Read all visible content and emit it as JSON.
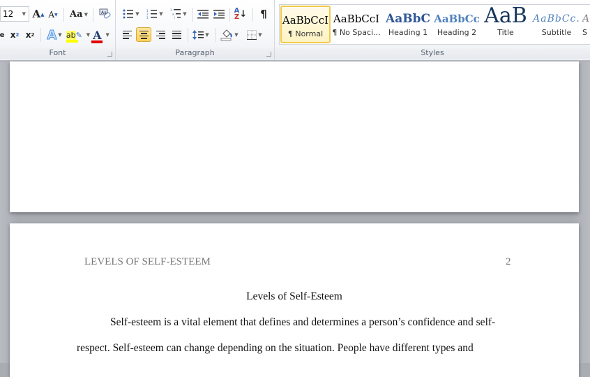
{
  "ribbon": {
    "font_group": {
      "label": "Font",
      "font_size": "12",
      "grow_font": "A",
      "shrink_font": "A",
      "change_case": "Aa",
      "subscript": "x",
      "superscript": "x",
      "text_effects": "A",
      "highlight_text": "ab",
      "font_color": "A",
      "highlight_color": "#ffff00",
      "font_color_value": "#ff0000"
    },
    "paragraph_group": {
      "label": "Paragraph",
      "show_marks": "¶",
      "sort": "A↓",
      "active_alignment": "center"
    },
    "styles_group": {
      "label": "Styles",
      "items": [
        {
          "preview": "AaBbCcI",
          "name": "¶ Normal",
          "selected": true
        },
        {
          "preview": "AaBbCcI",
          "name": "¶ No Spaci...",
          "selected": false
        },
        {
          "preview": "AaBbC",
          "name": "Heading 1",
          "selected": false
        },
        {
          "preview": "AaBbCc",
          "name": "Heading 2",
          "selected": false
        },
        {
          "preview": "AaB",
          "name": "Title",
          "selected": false
        },
        {
          "preview": "AaBbCc.",
          "name": "Subtitle",
          "selected": false
        },
        {
          "preview": "A",
          "name": "S",
          "selected": false
        }
      ]
    }
  },
  "document": {
    "page2": {
      "running_head": "LEVELS OF SELF-ESTEEM",
      "page_number": "2",
      "title": "Levels of Self-Esteem",
      "lines": [
        "Self-esteem is a vital element that defines and determines a person’s confidence and self-",
        "respect. Self-esteem can change depending on the situation. People have different types and"
      ]
    }
  }
}
